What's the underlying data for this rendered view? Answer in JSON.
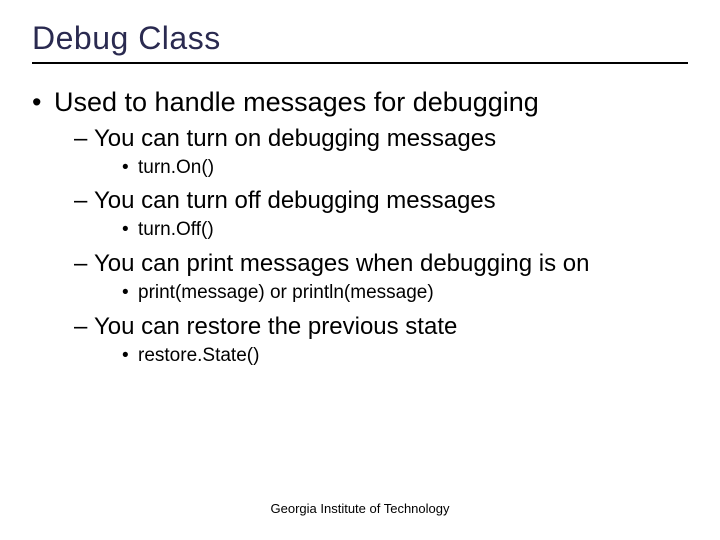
{
  "title": "Debug Class",
  "main_bullet": "Used to handle messages for debugging",
  "items": [
    {
      "sub": "You can turn on debugging messages",
      "detail": "turn.On()"
    },
    {
      "sub": "You can turn off debugging messages",
      "detail": "turn.Off()"
    },
    {
      "sub": "You can print messages when debugging is on",
      "detail": "print(message) or println(message)"
    },
    {
      "sub": "You can restore the previous state",
      "detail": "restore.State()"
    }
  ],
  "footer": "Georgia Institute of Technology"
}
